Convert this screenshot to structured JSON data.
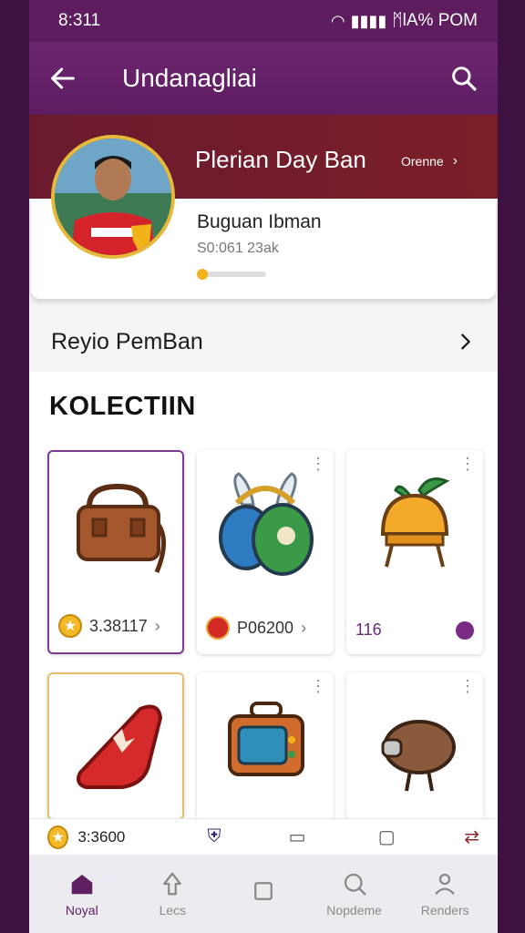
{
  "statusbar": {
    "time": "8:311",
    "right_text": "ᛗlA%  POM"
  },
  "appbar": {
    "title": "Undanagliai"
  },
  "profile": {
    "name": "Plerian Day Ban",
    "link": "Orenne",
    "subtitle": "Buguan Ibman",
    "meta": "S0:061 23ak",
    "progress_percent": 15
  },
  "row": {
    "label": "Reyio PemBan"
  },
  "collection": {
    "title": "KOLECTIIN",
    "items": [
      {
        "name": "leather-bag",
        "badge": "star",
        "value": "3.38117",
        "arrow": "›"
      },
      {
        "name": "rabbit-pouch",
        "badge": "red",
        "value": "P06200",
        "arrow": "›"
      },
      {
        "name": "orange-pot",
        "badge": "",
        "value": "116",
        "arrow": ""
      },
      {
        "name": "red-bag",
        "badge": "",
        "value": "",
        "arrow": ""
      },
      {
        "name": "suitcase",
        "badge": "",
        "value": "",
        "arrow": ""
      },
      {
        "name": "bird-robot",
        "badge": "",
        "value": "",
        "arrow": ""
      }
    ]
  },
  "strip": {
    "value": "3:3600"
  },
  "bottom_nav": {
    "items": [
      {
        "label": "Noyal",
        "active": true
      },
      {
        "label": "Lecs",
        "active": false
      },
      {
        "label": "",
        "active": false
      },
      {
        "label": "Nopdeme",
        "active": false
      },
      {
        "label": "Renders",
        "active": false
      }
    ]
  }
}
